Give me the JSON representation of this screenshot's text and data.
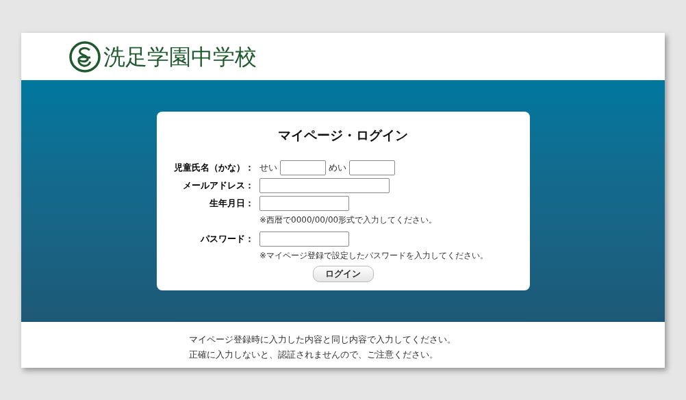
{
  "header": {
    "school_name": "洗足学園中学校"
  },
  "login": {
    "title": "マイページ・ログイン",
    "name_row": {
      "label": "児童氏名（かな）：",
      "sei": "せい",
      "mei": "めい"
    },
    "fields": [
      {
        "label": "メールアドレス：",
        "kind": "wide"
      },
      {
        "label": "生年月日：",
        "kind": "short",
        "note": "※西暦で0000/00/00形式で入力してください。"
      },
      {
        "label": "パスワード：",
        "kind": "short",
        "note": "※マイページ登録で設定したパスワードを入力してください。"
      }
    ],
    "button": "ログイン"
  },
  "footer": {
    "lines": [
      "マイページ登録時に入力した内容と同じ内容で入力してください。",
      "正確に入力しないと、認証されませんので、ご注意ください。"
    ]
  }
}
